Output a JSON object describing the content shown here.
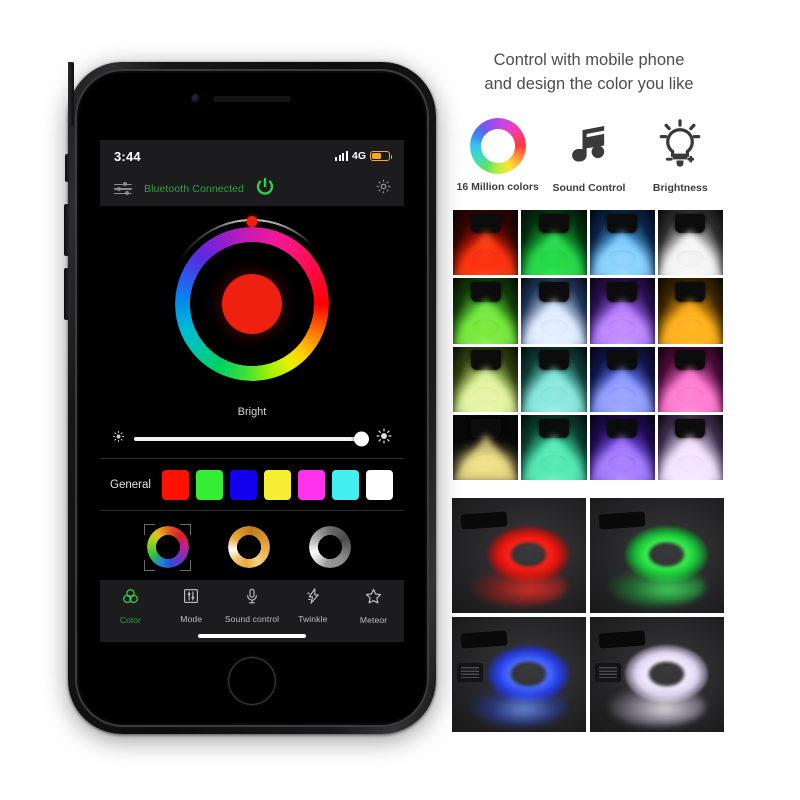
{
  "phone": {
    "status_bar": {
      "time": "3:44",
      "network": "4G",
      "signal_icon": "signal-bars-icon",
      "battery_icon": "battery-icon"
    },
    "app_bar": {
      "menu_icon": "sliders-menu-icon",
      "connection_status": "Bluetooth Connected",
      "status_color": "#2f9e44",
      "power_icon": "power-icon",
      "settings_icon": "gear-icon"
    },
    "color_wheel": {
      "selected_color": "#f02010",
      "handle_color": "#f02010",
      "handle_angle_deg": 0
    },
    "brightness": {
      "label": "Bright",
      "value_percent": 95,
      "low_icon": "sun-small-icon",
      "high_icon": "sun-large-icon"
    },
    "general_colors": {
      "label": "General",
      "swatches": [
        {
          "name": "red",
          "hex": "#ff1100"
        },
        {
          "name": "green",
          "hex": "#33ee33"
        },
        {
          "name": "blue",
          "hex": "#1100ee"
        },
        {
          "name": "yellow",
          "hex": "#f5ee33"
        },
        {
          "name": "magenta",
          "hex": "#ff33ee"
        },
        {
          "name": "cyan",
          "hex": "#44eeee"
        },
        {
          "name": "white",
          "hex": "#ffffff"
        }
      ]
    },
    "presets": [
      {
        "name": "rainbow-ring",
        "selected": true
      },
      {
        "name": "amber-ring",
        "selected": false
      },
      {
        "name": "grayscale-ring",
        "selected": false
      }
    ],
    "nav": [
      {
        "label": "Color",
        "icon": "color-circles-icon",
        "active": true
      },
      {
        "label": "Mode",
        "icon": "sliders-box-icon",
        "active": false
      },
      {
        "label": "Sound control",
        "icon": "microphone-icon",
        "active": false
      },
      {
        "label": "Twinkle",
        "icon": "lightning-bolt-icon",
        "active": false
      },
      {
        "label": "Meteor",
        "icon": "star-icon",
        "active": false
      }
    ]
  },
  "marketing": {
    "headline_line1": "Control with mobile phone",
    "headline_line2": "and design the color you like",
    "features": [
      {
        "label": "16 Million colors",
        "icon": "color-wheel-icon"
      },
      {
        "label": "Sound Control",
        "icon": "music-note-icon"
      },
      {
        "label": "Brightness",
        "icon": "light-bulb-icon"
      }
    ],
    "spotlight_grid": {
      "rows": 4,
      "cols": 4,
      "cells": [
        {
          "color": "#ff2a18"
        },
        {
          "color": "#27d94a"
        },
        {
          "color": "#6fd0ff"
        },
        {
          "color": "#f2f2f2"
        },
        {
          "color": "#6ee03a"
        },
        {
          "color": "#cfe6ff"
        },
        {
          "color": "#b56bff"
        },
        {
          "color": "#ffb01f"
        },
        {
          "color": "#e8f0a8"
        },
        {
          "color": "#7fe6d8"
        },
        {
          "color": "#6a7bff"
        },
        {
          "color": "#ff6ad0"
        },
        {
          "color": "#f0e07a"
        },
        {
          "color": "#3fe0a0"
        },
        {
          "color": "#7a4fff"
        },
        {
          "color": "#f0d8ff"
        }
      ]
    },
    "fiber_grid": {
      "rows": 2,
      "cols": 2,
      "cells": [
        {
          "color": "#ff1a1a"
        },
        {
          "color": "#2aee3a"
        },
        {
          "color": "#3a5cff"
        },
        {
          "color": "#ddd4f0"
        }
      ]
    }
  }
}
